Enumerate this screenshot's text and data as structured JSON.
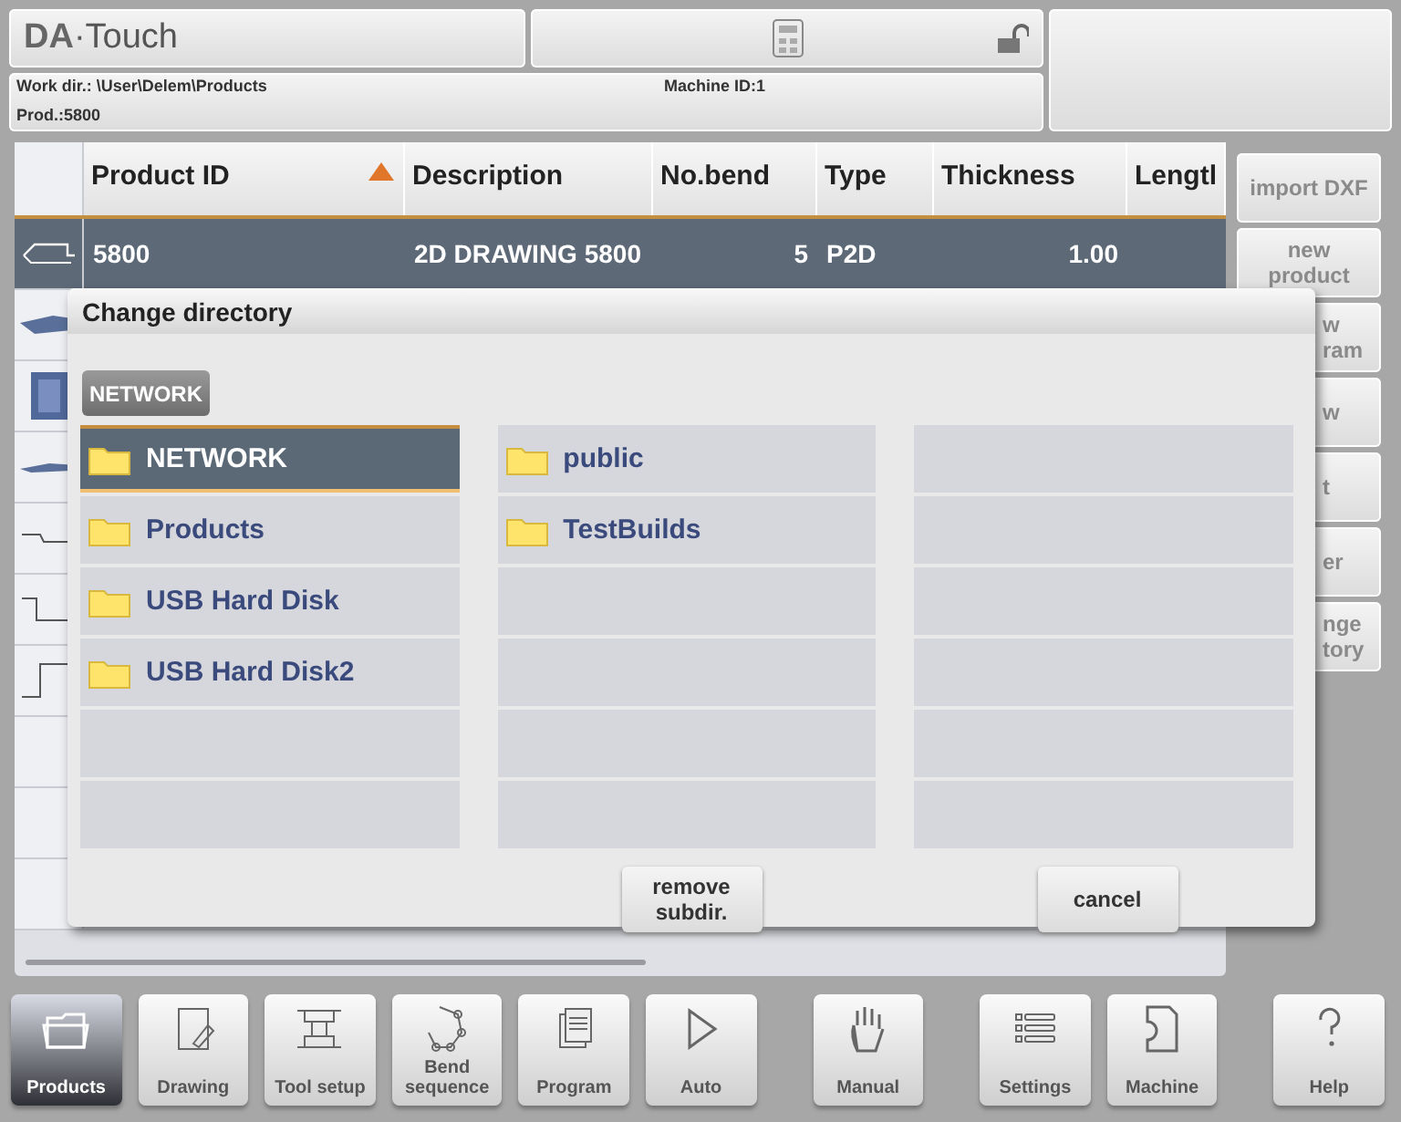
{
  "header": {
    "logo": "**DA**·Touch",
    "work_dir": "Work dir.: \\User\\Delem\\Products",
    "machine_id": "Machine ID:1",
    "product": "Prod.:5800",
    "locked": false
  },
  "table": {
    "columns": [
      {
        "label": "Product ID",
        "sorted": true
      },
      {
        "label": "Description",
        "sorted": false
      },
      {
        "label": "No.bend",
        "sorted": false
      },
      {
        "label": "Type",
        "sorted": false
      },
      {
        "label": "Thickness",
        "sorted": false
      },
      {
        "label": "Lengtl",
        "sorted": false
      }
    ],
    "rows": [
      {
        "cells": [
          "5800",
          "2D DRAWING 5800",
          "5",
          "P2D",
          "1.00"
        ],
        "selected": true
      }
    ]
  },
  "side_buttons": [
    {
      "label": "import DXF",
      "covered": false
    },
    {
      "label": "new product",
      "covered": false
    },
    {
      "label": "w ram",
      "covered": true
    },
    {
      "label": "w",
      "covered": true
    },
    {
      "label": "t",
      "covered": true
    },
    {
      "label": "er",
      "covered": true
    },
    {
      "label": "nge tory",
      "covered": true
    }
  ],
  "dialog": {
    "title": "Change directory",
    "path_button": "NETWORK",
    "columns": [
      [
        {
          "label": "NETWORK",
          "selected": true
        },
        {
          "label": "Products",
          "selected": false
        },
        {
          "label": "USB Hard Disk",
          "selected": false
        },
        {
          "label": "USB Hard Disk2",
          "selected": false
        }
      ],
      [
        {
          "label": "public",
          "selected": false
        },
        {
          "label": "TestBuilds",
          "selected": false
        }
      ]
    ],
    "buttons": [
      "remove subdir.",
      "cancel"
    ]
  },
  "nav": [
    {
      "label": "Products",
      "selected": true
    },
    {
      "label": "Drawing",
      "selected": false
    },
    {
      "label": "Tool setup",
      "selected": false
    },
    {
      "label": "Bend sequence",
      "selected": false
    },
    {
      "label": "Program",
      "selected": false
    },
    {
      "label": "Auto",
      "selected": false
    },
    {
      "label": "Manual",
      "selected": false
    },
    {
      "label": "Settings",
      "selected": false
    },
    {
      "label": "Machine",
      "selected": false
    },
    {
      "label": "Help",
      "selected": false
    }
  ]
}
